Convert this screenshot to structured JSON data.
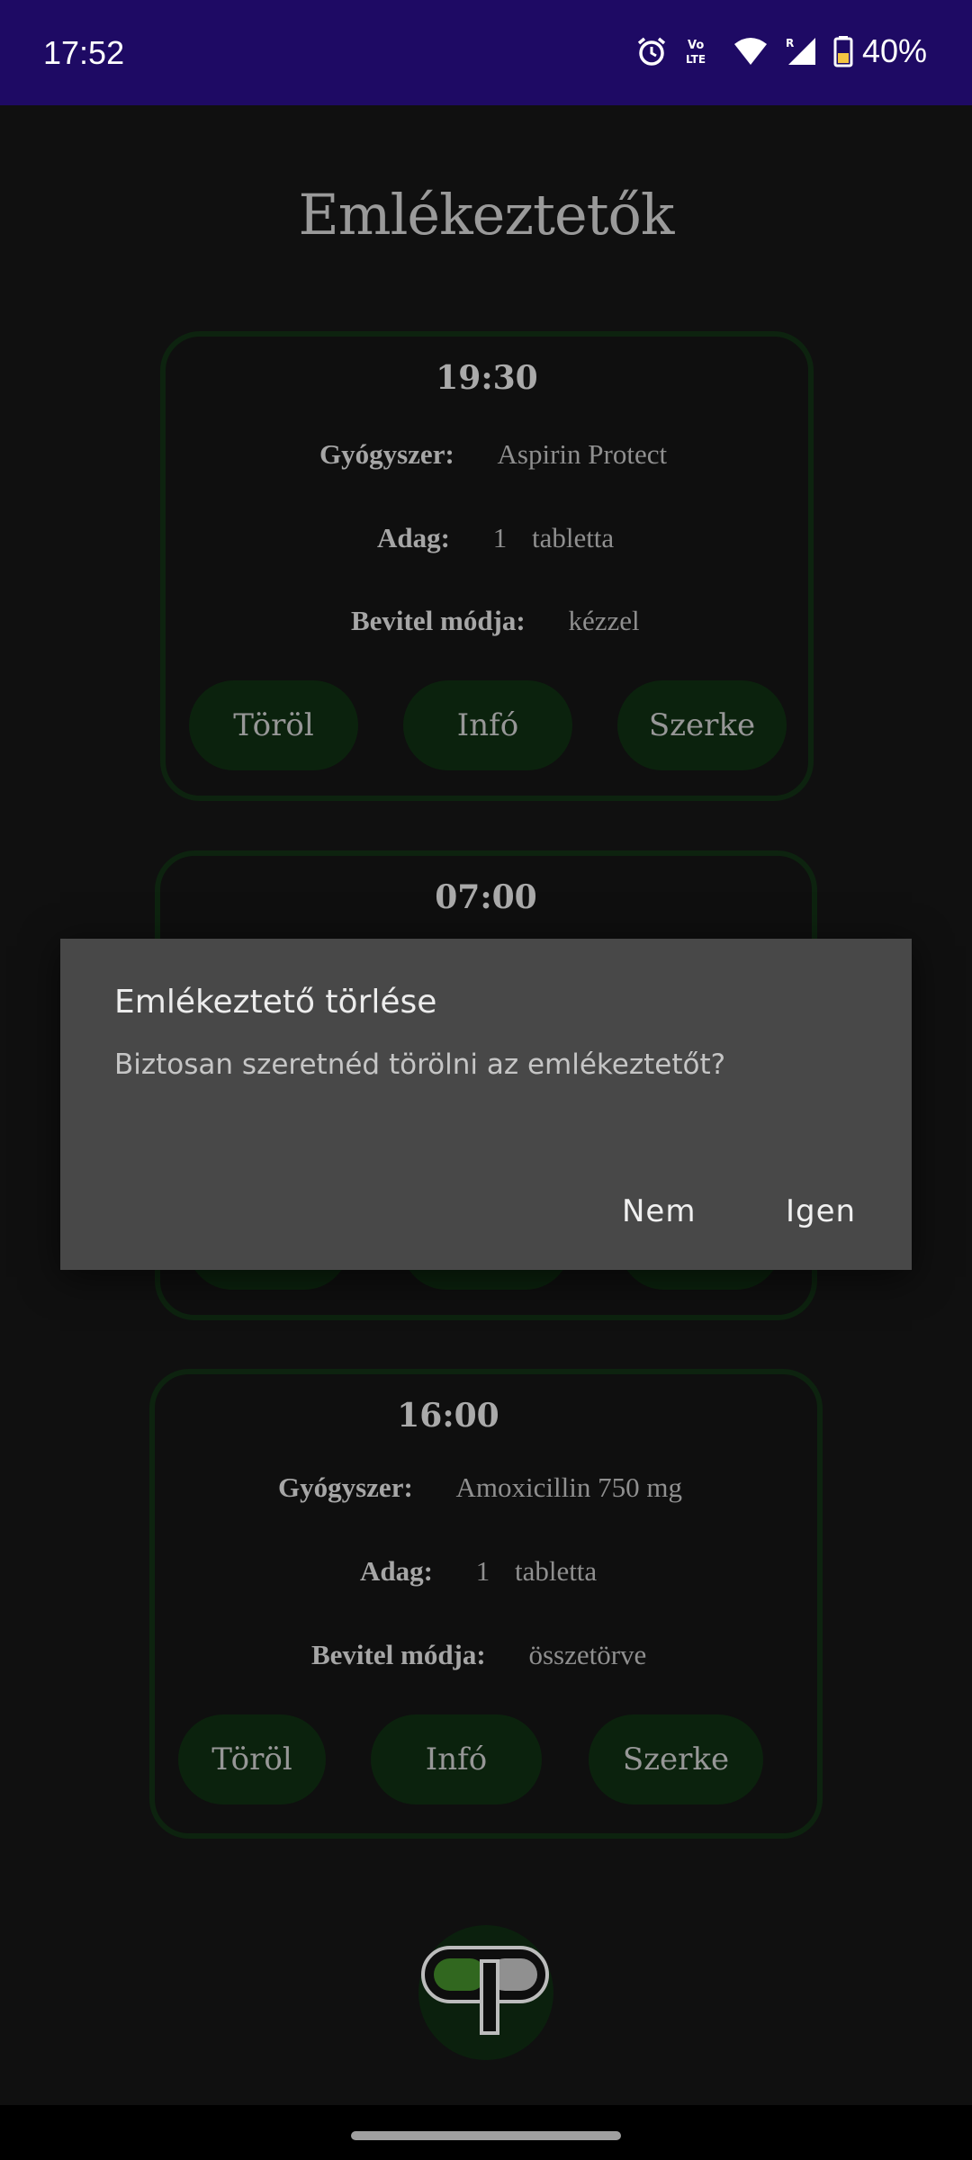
{
  "status_bar": {
    "time": "17:52",
    "battery": "40%",
    "icons": [
      "alarm-icon",
      "volte-icon",
      "wifi-icon",
      "signal-icon",
      "battery-icon"
    ]
  },
  "page": {
    "title": "Emlékeztetők"
  },
  "reminders": [
    {
      "time": "19:30",
      "medicine_label": "Gyógyszer:",
      "medicine": "Aspirin Protect",
      "dose_label": "Adag:",
      "dose_amount": "1",
      "dose_unit": "tabletta",
      "method_label": "Bevitel módja:",
      "method": "kézzel",
      "delete": "Töröl",
      "info": "Infó",
      "edit": "Szerke"
    },
    {
      "time": "07:00"
    },
    {
      "time": "16:00",
      "medicine_label": "Gyógyszer:",
      "medicine": "Amoxicillin 750 mg",
      "dose_label": "Adag:",
      "dose_amount": "1",
      "dose_unit": "tabletta",
      "method_label": "Bevitel módja:",
      "method": "összetörve",
      "delete": "Töröl",
      "info": "Infó",
      "edit": "Szerke"
    }
  ],
  "dialog": {
    "title": "Emlékeztető törlése",
    "message": "Biztosan szeretnéd törölni az emlékeztetőt?",
    "negative": "Nem",
    "positive": "Igen"
  },
  "fab": {
    "icon": "pill-logo-icon"
  },
  "colors": {
    "status_bar": "#1e0a64",
    "background": "#131313",
    "card_border": "#102a12",
    "button_bg": "#0e2910",
    "dialog_bg": "#484848"
  }
}
